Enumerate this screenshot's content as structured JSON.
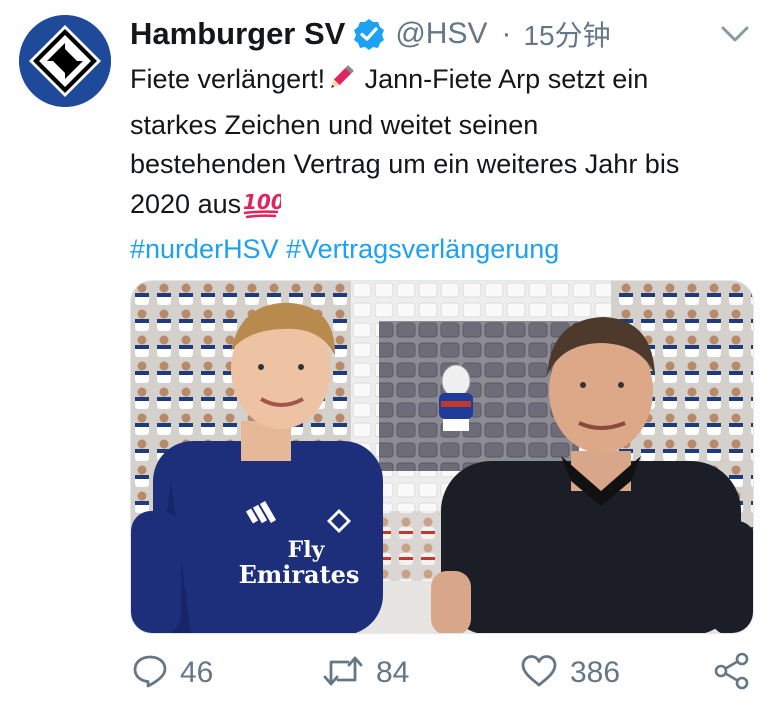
{
  "tweet": {
    "display_name": "Hamburger SV",
    "handle": "@HSV",
    "separator": "·",
    "time": "15分钟",
    "text_lines": [
      "Fiete verlängert!",
      " Jann-Fiete Arp setzt ein",
      "starkes Zeichen und weitet seinen",
      "bestehenden Vertrag um ein weiteres Jahr bis",
      "2020 aus"
    ],
    "hashtags": [
      "#nurderHSV",
      "#Vertragsverlängerung"
    ],
    "emoji_icons": [
      "pencil-emoji",
      "hundred-points-emoji"
    ]
  },
  "media": {
    "jersey_text_line1": "Fly",
    "jersey_text_line2": "Emirates",
    "description_icon": "photo"
  },
  "actions": {
    "reply_count": "46",
    "retweet_count": "84",
    "like_count": "386"
  },
  "colors": {
    "accent": "#1da1f2",
    "secondary_text": "#657786",
    "primary_text": "#14171a",
    "brand_blue": "#1f4a9a"
  }
}
